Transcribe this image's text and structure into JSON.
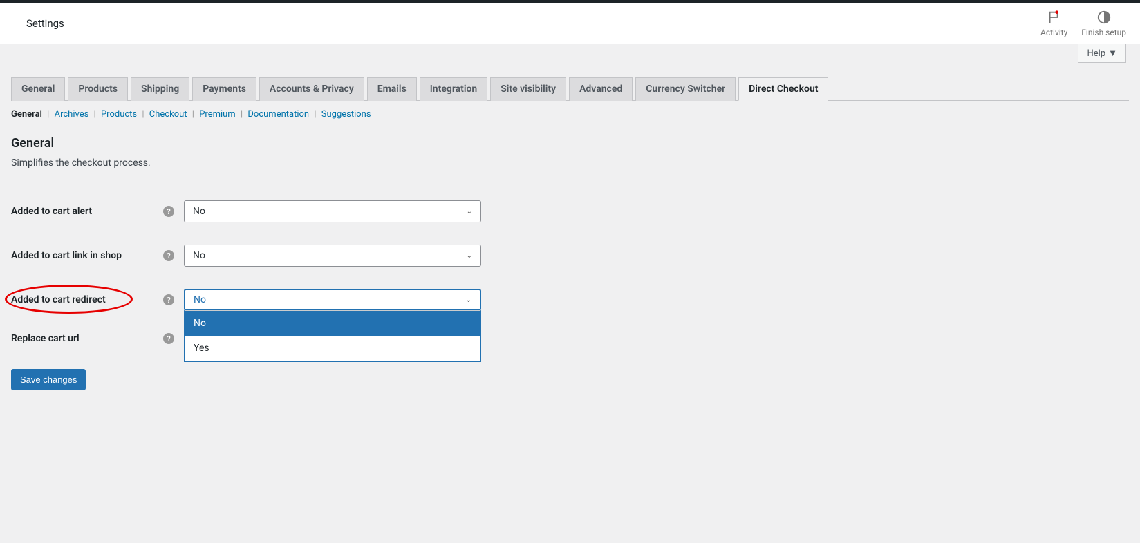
{
  "header": {
    "title": "Settings",
    "activity_label": "Activity",
    "finish_setup_label": "Finish setup",
    "help_label": "Help"
  },
  "nav_tabs": [
    {
      "label": "General"
    },
    {
      "label": "Products"
    },
    {
      "label": "Shipping"
    },
    {
      "label": "Payments"
    },
    {
      "label": "Accounts & Privacy"
    },
    {
      "label": "Emails"
    },
    {
      "label": "Integration"
    },
    {
      "label": "Site visibility"
    },
    {
      "label": "Advanced"
    },
    {
      "label": "Currency Switcher"
    },
    {
      "label": "Direct Checkout"
    }
  ],
  "subsubsub": [
    {
      "label": "General"
    },
    {
      "label": "Archives"
    },
    {
      "label": "Products"
    },
    {
      "label": "Checkout"
    },
    {
      "label": "Premium"
    },
    {
      "label": "Documentation"
    },
    {
      "label": "Suggestions"
    }
  ],
  "section": {
    "heading": "General",
    "description": "Simplifies the checkout process."
  },
  "fields": {
    "added_to_cart_alert": {
      "label": "Added to cart alert",
      "value": "No"
    },
    "added_to_cart_link": {
      "label": "Added to cart link in shop",
      "value": "No"
    },
    "added_to_cart_redirect": {
      "label": "Added to cart redirect",
      "value": "No",
      "options": [
        "No",
        "Yes"
      ]
    },
    "replace_cart_url": {
      "label": "Replace cart url",
      "value": ""
    }
  },
  "submit": {
    "label": "Save changes"
  }
}
